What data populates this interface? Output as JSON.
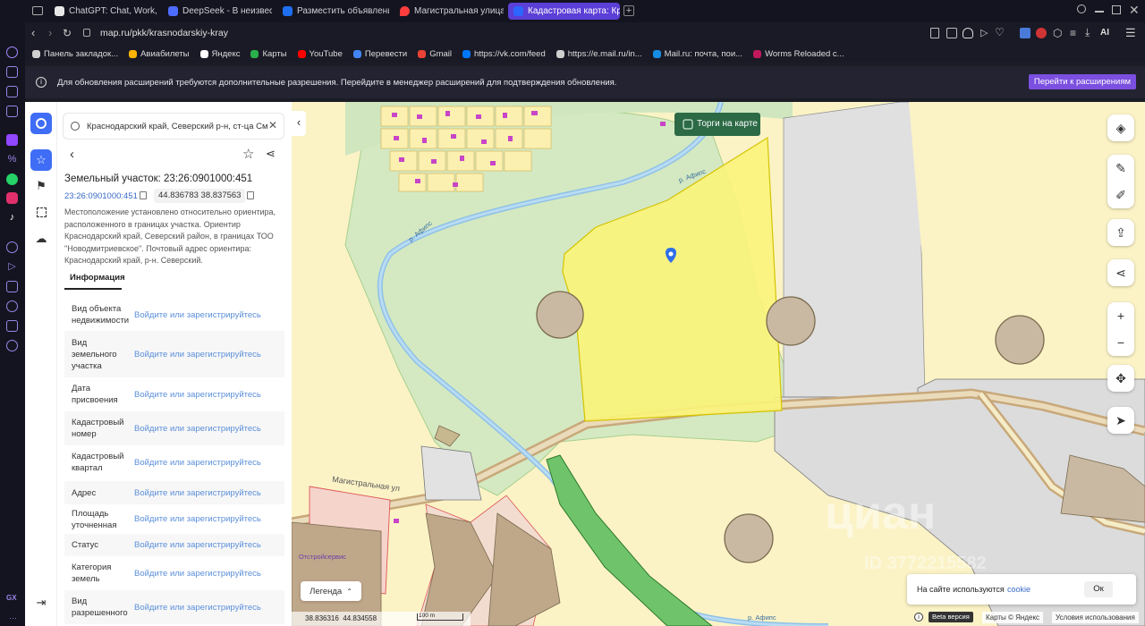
{
  "browser": {
    "tabs": [
      {
        "label": "ChatGPT: Chat, Work, Crea",
        "color": "#e8e8e8"
      },
      {
        "label": "DeepSeek - В неизвестно",
        "color": "#4d6bfe"
      },
      {
        "label": "Разместить объявление о",
        "color": "#1e6ff0"
      },
      {
        "label": "Магистральная улица — Я",
        "color": "#ff3d3d"
      },
      {
        "label": "Кадастровая карта: Красн",
        "color": "#2c66ff"
      }
    ],
    "url": "map.ru/pkk/krasnodarskiy-kray",
    "ai_label": "AI",
    "bookmarks": [
      {
        "label": "Панель закладок...",
        "color": "#cfcfcf"
      },
      {
        "label": "Авиабилеты",
        "color": "#ffb400"
      },
      {
        "label": "Яндекс",
        "color": "#ffffff"
      },
      {
        "label": "Карты",
        "color": "#2ab04a"
      },
      {
        "label": "YouTube",
        "color": "#ff0000"
      },
      {
        "label": "Перевести",
        "color": "#4285f4"
      },
      {
        "label": "Gmail",
        "color": "#ea4335"
      },
      {
        "label": "https://vk.com/feed",
        "color": "#0077ff"
      },
      {
        "label": "https://e.mail.ru/in...",
        "color": "#cfcfcf"
      },
      {
        "label": "Mail.ru: почта, пои...",
        "color": "#168de2"
      },
      {
        "label": "Worms Reloaded c...",
        "color": "#c2185b"
      }
    ],
    "notice": "Для обновления расширений требуются дополнительные разрешения. Перейдите в менеджер расширений для подтверждения обновления.",
    "notice_button": "Перейти к расширениям",
    "rail_badge": "GX"
  },
  "panel": {
    "search_value": "Краснодарский край, Северский р-н, ст-ца См",
    "title": "Земельный участок: 23:26:0901000:451",
    "cadnum": "23:26:0901000:451",
    "coords": "44.836783 38.837563",
    "description": "Местоположение установлено относительно ориентира, расположенного в границах участка. Ориентир Краснодарский край, Северский район, в границах ТОО \"Новодмитриевское\". Почтовый адрес ориентира: Краснодарский край, р-н. Северский.",
    "info_tab": "Информация",
    "rows": [
      {
        "key": "Вид объекта недвижимости",
        "value": "Войдите или зарегистрируйтесь"
      },
      {
        "key": "Вид земельного участка",
        "value": "Войдите или зарегистрируйтесь"
      },
      {
        "key": "Дата присвоения",
        "value": "Войдите или зарегистрируйтесь"
      },
      {
        "key": "Кадастровый номер",
        "value": "Войдите или зарегистрируйтесь"
      },
      {
        "key": "Кадастровый квартал",
        "value": "Войдите или зарегистрируйтесь"
      },
      {
        "key": "Адрес",
        "value": "Войдите или зарегистрируйтесь"
      },
      {
        "key": "Площадь уточненная",
        "value": "Войдите или зарегистрируйтесь"
      },
      {
        "key": "Статус",
        "value": "Войдите или зарегистрируйтесь"
      },
      {
        "key": "Категория земель",
        "value": "Войдите или зарегистрируйтесь"
      },
      {
        "key": "Вид разрешенного",
        "value": "Войдите или зарегистрируйтесь"
      }
    ]
  },
  "map": {
    "torgi_label": "Торги на карте",
    "street_label": "Магистральная ул",
    "river_label1": "р. Афипс",
    "river_label2": "р. Афипс",
    "river_label3": "р. Афипс",
    "poi_label": "Отстройсервис",
    "legend_label": "Легенда",
    "scale_coords": "38.836316  44.834558",
    "scale_label": "100 m",
    "cookie_text": "На сайте используются ",
    "cookie_link": "cookie",
    "cookie_ok": "Ок",
    "beta_label": "Beta версия",
    "attribution": "Карты © Яндекс",
    "terms": "Условия использования",
    "watermark": "циан",
    "watermark_id": "ID 3772215582"
  }
}
